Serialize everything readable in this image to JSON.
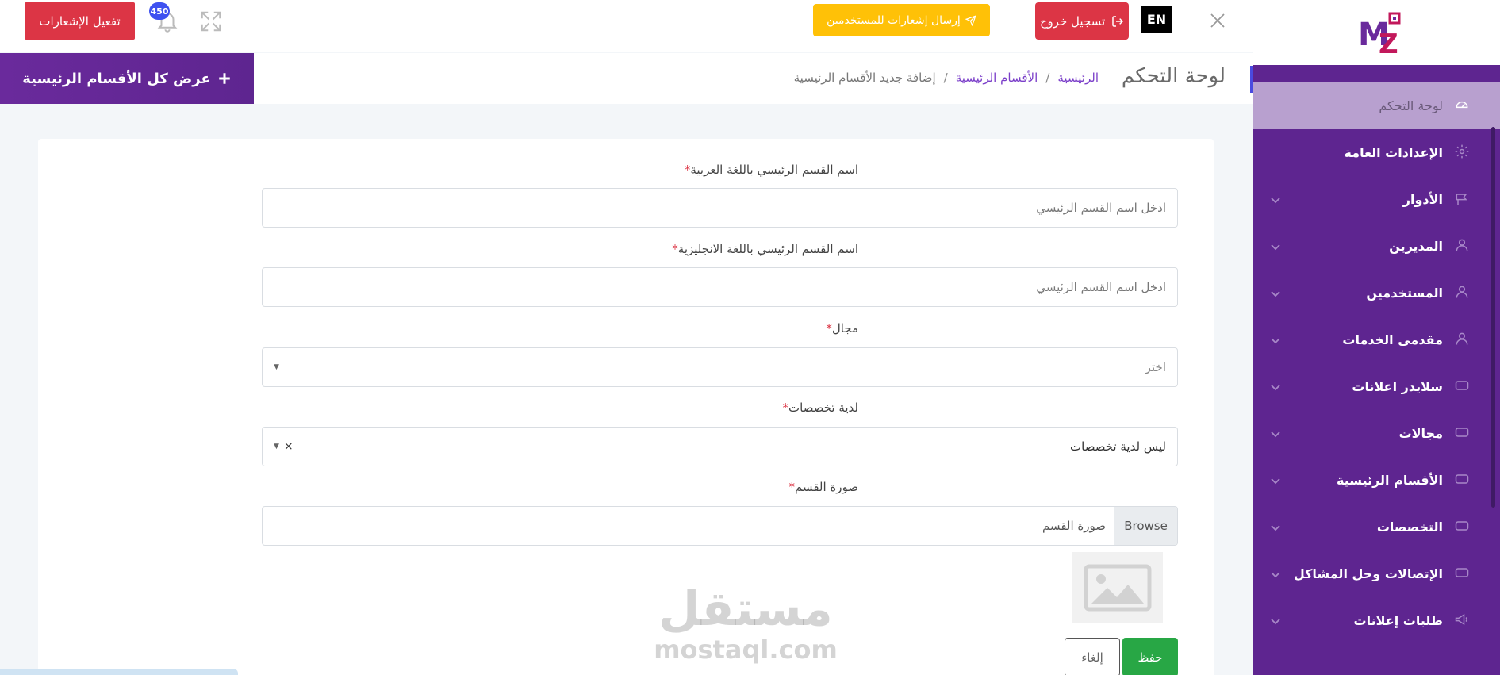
{
  "topbar": {
    "activate_notifications": "تفعيل الإشعارات",
    "notification_count": "450",
    "send_notifications": "إرسال إشعارات للمستخدمين",
    "logout": "تسجيل خروج",
    "language": "EN"
  },
  "subheader": {
    "view_all": "عرض كل الأقسام الرئيسية",
    "page_title": "لوحة التحكم",
    "breadcrumb": {
      "home": "الرئيسية",
      "sep": "/",
      "sections": "الأقسام الرئيسية",
      "current": "إضافة جديد الأقسام الرئيسية"
    }
  },
  "form": {
    "name_ar": {
      "label": "اسم القسم الرئيسي باللغة العربية",
      "required": "*",
      "placeholder": "ادخل اسم القسم الرئيسي"
    },
    "name_en": {
      "label": "اسم القسم الرئيسي باللغة الانجليزية",
      "required": "*",
      "placeholder": "ادخل اسم القسم الرئيسي"
    },
    "field": {
      "label": "مجال",
      "required": "*",
      "placeholder": "اختر"
    },
    "has_specialties": {
      "label": "لدية تخصصات",
      "required": "*",
      "value": "ليس لدية تخصصات",
      "clear": "×"
    },
    "image": {
      "label": "صورة القسم",
      "required": "*",
      "browse": "Browse",
      "file_text": "صورة القسم"
    },
    "save": "حفظ",
    "cancel": "إلغاء"
  },
  "watermark": {
    "ar": "مستقل",
    "en": "mostaql.com"
  },
  "sidebar": {
    "items": [
      {
        "label": "لوحة التحكم",
        "icon": "dashboard-icon",
        "active": true
      },
      {
        "label": "الإعدادات العامة",
        "icon": "gear-icon"
      },
      {
        "label": "الأدوار",
        "icon": "pin-icon"
      },
      {
        "label": "المديرين",
        "icon": "user-icon"
      },
      {
        "label": "المستخدمين",
        "icon": "user-icon"
      },
      {
        "label": "مقدمى الخدمات",
        "icon": "user-icon"
      },
      {
        "label": "سلايدر اعلانات",
        "icon": "card-icon"
      },
      {
        "label": "مجالات",
        "icon": "card-icon"
      },
      {
        "label": "الأقسام الرئيسية",
        "icon": "card-icon"
      },
      {
        "label": "التخصصات",
        "icon": "card-icon"
      },
      {
        "label": "الإتصالات وحل المشاكل",
        "icon": "card-icon"
      },
      {
        "label": "طلبات إعلانات",
        "icon": "megaphone-icon"
      }
    ]
  },
  "colors": {
    "sidebar": "#5e2590",
    "danger": "#dc3545",
    "warning": "#ffc107",
    "success": "#28a745",
    "link": "#7b3fc9"
  }
}
